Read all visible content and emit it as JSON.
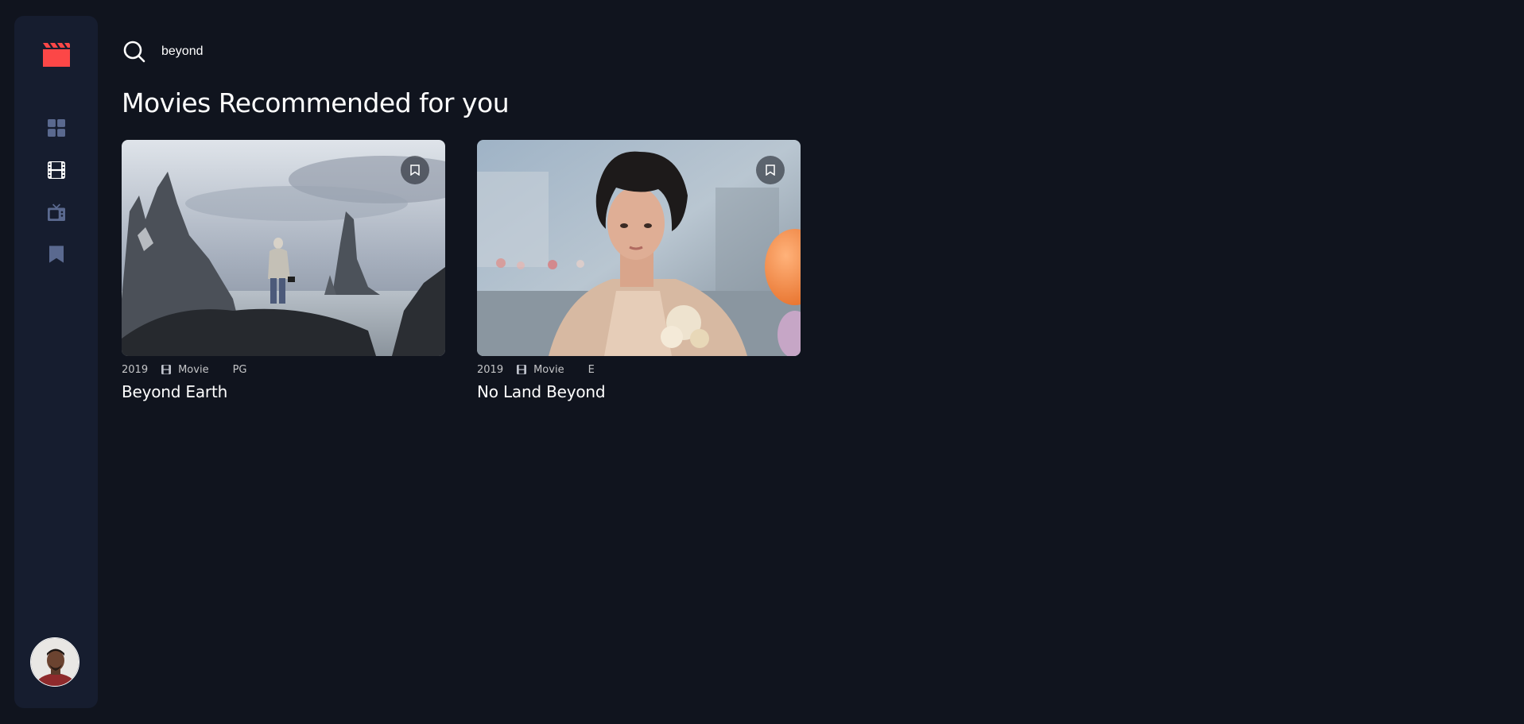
{
  "app": {
    "accent_color": "#fc4747",
    "background_color": "#10141e",
    "sidebar_color": "#161d2f"
  },
  "sidebar": {
    "logo_icon": "film-clapper-icon",
    "items": [
      {
        "name": "home",
        "icon": "grid-icon",
        "active": false
      },
      {
        "name": "movies",
        "icon": "film-icon",
        "active": true
      },
      {
        "name": "tv-series",
        "icon": "tv-icon",
        "active": false
      },
      {
        "name": "bookmarks",
        "icon": "bookmark-icon",
        "active": false
      }
    ],
    "avatar": "user-avatar"
  },
  "search": {
    "value": "beyond",
    "icon": "search-icon"
  },
  "section": {
    "title": "Movies Recommended for you"
  },
  "results": [
    {
      "title": "Beyond Earth",
      "year": "2019",
      "category": "Movie",
      "rating": "PG",
      "bookmarked": false
    },
    {
      "title": "No Land Beyond",
      "year": "2019",
      "category": "Movie",
      "rating": "E",
      "bookmarked": false
    }
  ]
}
